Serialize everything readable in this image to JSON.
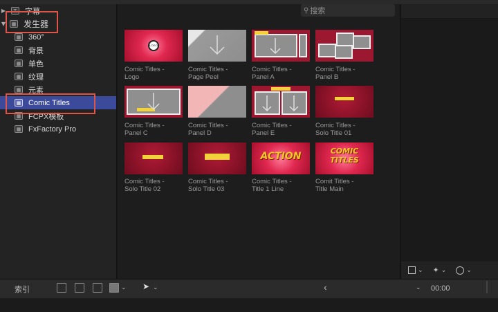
{
  "sidebar": {
    "items": [
      {
        "label": "字幕",
        "icon": "T"
      },
      {
        "label": "发生器",
        "icon": "▦"
      },
      {
        "label": "360°",
        "icon": "▦"
      },
      {
        "label": "背景",
        "icon": "▦"
      },
      {
        "label": "单色",
        "icon": "▦"
      },
      {
        "label": "纹理",
        "icon": "▦"
      },
      {
        "label": "元素",
        "icon": "▦"
      },
      {
        "label": "Comic Titles",
        "icon": "▦"
      },
      {
        "label": "FCPX模板",
        "icon": "▦"
      },
      {
        "label": "FxFactory Pro",
        "icon": "▦"
      }
    ]
  },
  "search": {
    "placeholder": "搜索"
  },
  "browser": {
    "tiles": [
      {
        "line1": "Comic Titles -",
        "line2": "Logo"
      },
      {
        "line1": "Comic Titles -",
        "line2": "Page Peel"
      },
      {
        "line1": "Comic Titles -",
        "line2": "Panel A"
      },
      {
        "line1": "Comic Titles -",
        "line2": "Panel B"
      },
      {
        "line1": "Comic Titles -",
        "line2": "Panel C"
      },
      {
        "line1": "Comic Titles -",
        "line2": "Panel D"
      },
      {
        "line1": "Comic Titles -",
        "line2": "Panel E"
      },
      {
        "line1": "Comic Titles -",
        "line2": "Solo Title 01"
      },
      {
        "line1": "Comic Titles -",
        "line2": "Solo Title 02"
      },
      {
        "line1": "Comic Titles -",
        "line2": "Solo Title 03"
      },
      {
        "line1": "Comic Titles -",
        "line2": "Title 1 Line"
      },
      {
        "line1": "Comit Titles -",
        "line2": "Title Main"
      }
    ],
    "thumb_text": {
      "logo": "LOGO",
      "action": "ACTION",
      "comic_titles": "COMIC TITLES"
    }
  },
  "toolbar": {
    "index_label": "索引",
    "timecode": "00:00",
    "chevron_left": "‹",
    "chevron_down": "⌄"
  },
  "colors": {
    "accent_selection": "#3b4a9a",
    "highlight_box": "#e0554a",
    "comic_red": "#c0213a"
  }
}
